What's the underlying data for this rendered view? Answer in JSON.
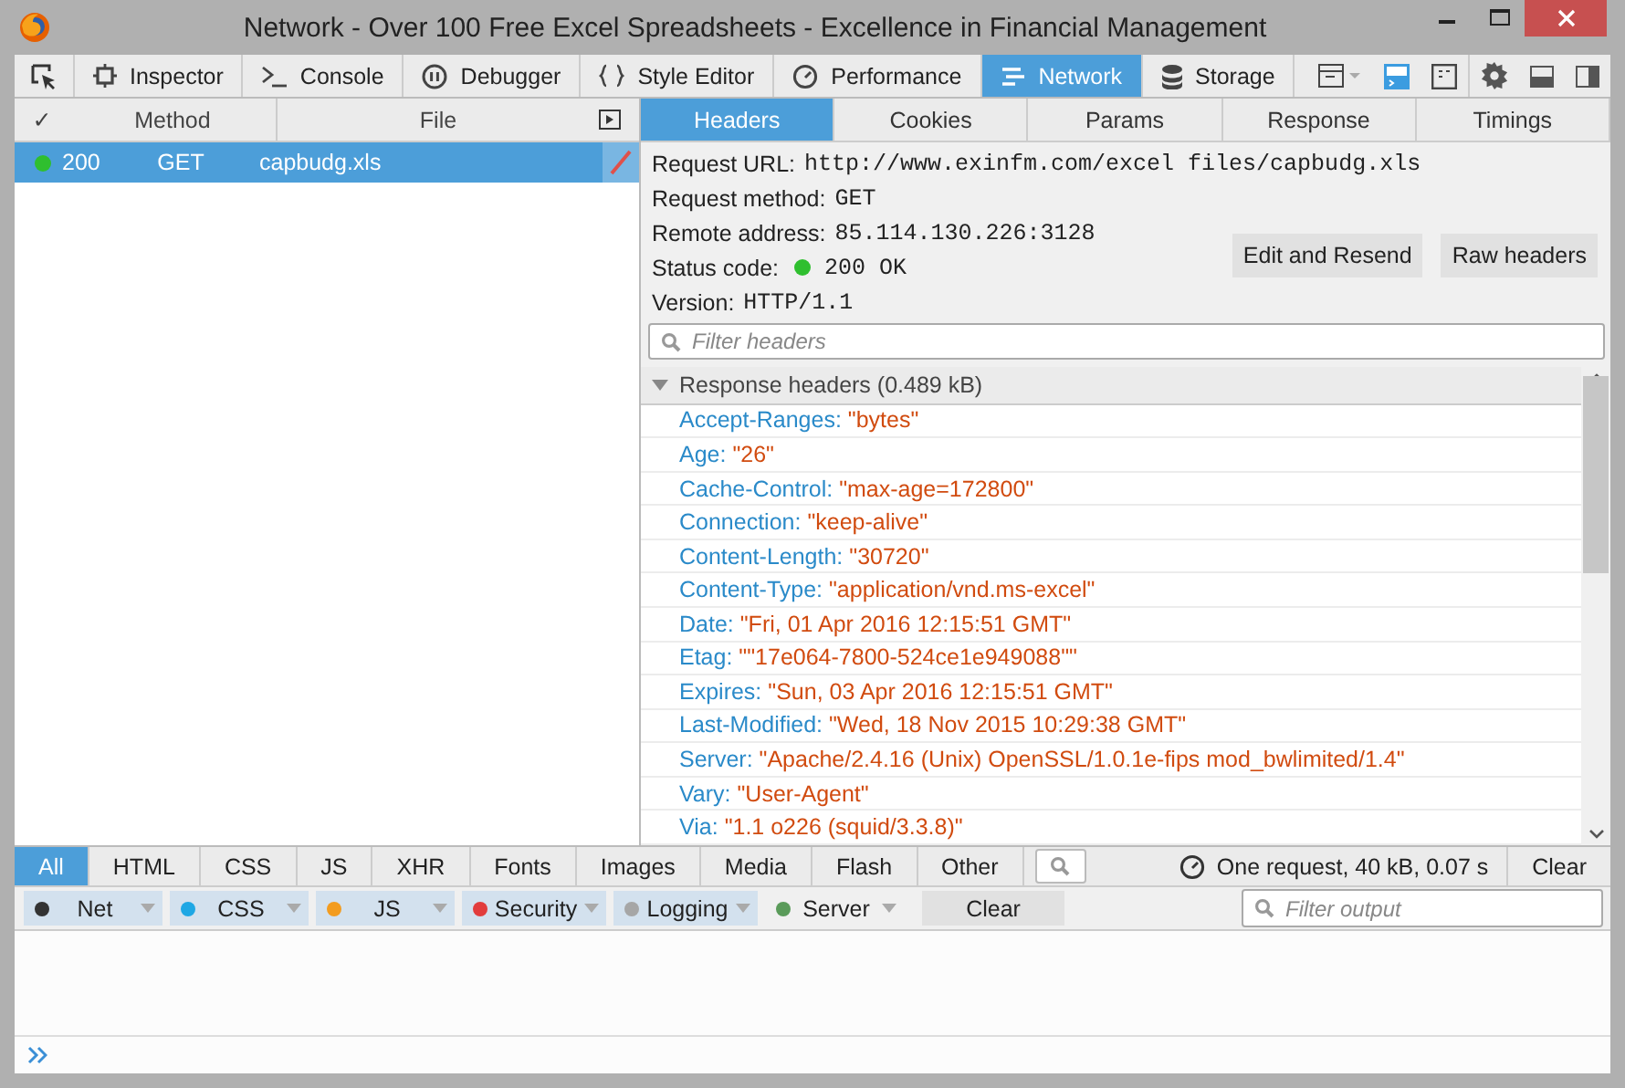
{
  "window": {
    "title": "Network - Over 100 Free Excel Spreadsheets - Excellence in Financial Management"
  },
  "toolbar": {
    "tools": [
      {
        "label": "Inspector",
        "selected": false
      },
      {
        "label": "Console",
        "selected": false
      },
      {
        "label": "Debugger",
        "selected": false
      },
      {
        "label": "Style Editor",
        "selected": false
      },
      {
        "label": "Performance",
        "selected": false
      },
      {
        "label": "Network",
        "selected": true
      },
      {
        "label": "Storage",
        "selected": false
      }
    ]
  },
  "requests": {
    "columns": [
      "✓",
      "Method",
      "File"
    ],
    "rows": [
      {
        "status": "200",
        "method": "GET",
        "file": "capbudg.xls",
        "color": "#2fbf2f",
        "selected": true
      }
    ]
  },
  "details": {
    "tabs": [
      {
        "label": "Headers",
        "selected": true
      },
      {
        "label": "Cookies",
        "selected": false
      },
      {
        "label": "Params",
        "selected": false
      },
      {
        "label": "Response",
        "selected": false
      },
      {
        "label": "Timings",
        "selected": false
      }
    ],
    "summary": [
      {
        "kind": "text",
        "label": "Request URL:",
        "value": "http://www.exinfm.com/excel files/capbudg.xls"
      },
      {
        "kind": "text",
        "label": "Request method:",
        "value": "GET"
      },
      {
        "kind": "text",
        "label": "Remote address:",
        "value": "85.114.130.226:3128"
      },
      {
        "kind": "status",
        "label": "Status code:",
        "value": "200 OK",
        "color": "#2fbf2f"
      },
      {
        "kind": "text",
        "label": "Version:",
        "value": "HTTP/1.1"
      }
    ],
    "buttons": [
      "Edit and Resend",
      "Raw headers"
    ],
    "filter": {
      "placeholder": "Filter headers"
    },
    "section": {
      "title": "Response headers (0.489 kB)",
      "expanded": true
    },
    "headers": [
      {
        "name": "Accept-Ranges:",
        "value": "\"bytes\""
      },
      {
        "name": "Age:",
        "value": "\"26\""
      },
      {
        "name": "Cache-Control:",
        "value": "\"max-age=172800\""
      },
      {
        "name": "Connection:",
        "value": "\"keep-alive\""
      },
      {
        "name": "Content-Length:",
        "value": "\"30720\""
      },
      {
        "name": "Content-Type:",
        "value": "\"application/vnd.ms-excel\""
      },
      {
        "name": "Date:",
        "value": "\"Fri, 01 Apr 2016 12:15:51 GMT\""
      },
      {
        "name": "Etag:",
        "value": "\"\"17e064-7800-524ce1e949088\"\""
      },
      {
        "name": "Expires:",
        "value": "\"Sun, 03 Apr 2016 12:15:51 GMT\""
      },
      {
        "name": "Last-Modified:",
        "value": "\"Wed, 18 Nov 2015 10:29:38 GMT\""
      },
      {
        "name": "Server:",
        "value": "\"Apache/2.4.16 (Unix) OpenSSL/1.0.1e-fips mod_bwlimited/1.4\""
      },
      {
        "name": "Vary:",
        "value": "\"User-Agent\""
      },
      {
        "name": "Via:",
        "value": "\"1.1 o226 (squid/3.3.8)\""
      }
    ]
  },
  "type_filters": [
    {
      "label": "All",
      "selected": true
    },
    {
      "label": "HTML",
      "selected": false
    },
    {
      "label": "CSS",
      "selected": false
    },
    {
      "label": "JS",
      "selected": false
    },
    {
      "label": "XHR",
      "selected": false
    },
    {
      "label": "Fonts",
      "selected": false
    },
    {
      "label": "Images",
      "selected": false
    },
    {
      "label": "Media",
      "selected": false
    },
    {
      "label": "Flash",
      "selected": false
    },
    {
      "label": "Other",
      "selected": false
    }
  ],
  "network_summary": "One request, 40 kB, 0.07 s",
  "network_clear": "Clear",
  "console": {
    "filters": [
      {
        "label": "Net",
        "color": "#333333",
        "on": true
      },
      {
        "label": "CSS",
        "color": "#1ea7e4",
        "on": true
      },
      {
        "label": "JS",
        "color": "#f39c1f",
        "on": true
      },
      {
        "label": "Security",
        "color": "#e23c3c",
        "on": true
      },
      {
        "label": "Logging",
        "color": "#a6a6a6",
        "on": true
      },
      {
        "label": "Server",
        "color": "#5a9b5a",
        "on": false
      }
    ],
    "clear": "Clear",
    "filter": {
      "placeholder": "Filter output"
    }
  }
}
